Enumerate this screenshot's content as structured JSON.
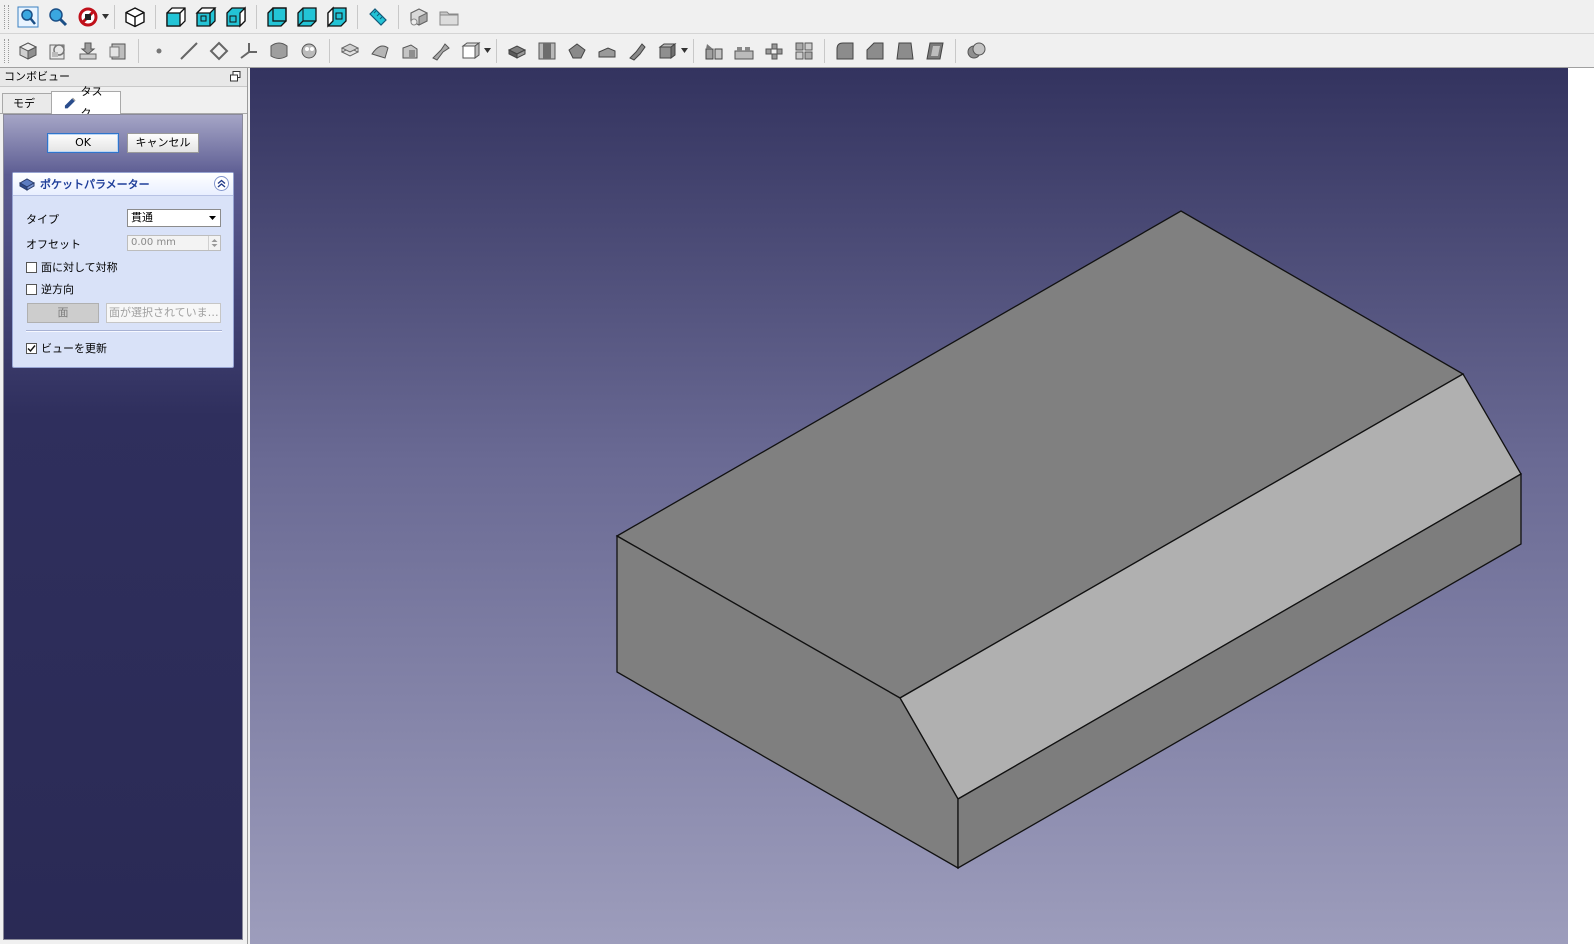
{
  "toolbar1": {
    "groups": [
      [
        "fit-all-icon",
        "fit-selection-icon",
        "draw-style-icon"
      ],
      [
        "isometric-view-icon"
      ],
      [
        "front-view-icon",
        "top-view-icon",
        "right-view-icon"
      ],
      [
        "rear-view-icon",
        "bottom-view-icon",
        "left-view-icon"
      ],
      [
        "measure-distance-icon"
      ],
      [
        "create-body-icon",
        "create-part-icon"
      ]
    ]
  },
  "toolbar2": {
    "icons": [
      "create-body-icon",
      "create-sketch-icon",
      "validate-sketch-icon",
      "clone-icon",
      "datum-point-icon",
      "datum-line-icon",
      "datum-plane-icon",
      "local-coordinate-icon",
      "shape-binder-icon",
      "subshape-binder-icon",
      "pad-icon",
      "revolution-icon",
      "additive-loft-icon",
      "additive-pipe-icon",
      "additive-primitive-icon",
      "pocket-icon",
      "hole-icon",
      "groove-icon",
      "subtractive-loft-icon",
      "subtractive-pipe-icon",
      "subtractive-primitive-icon",
      "mirrored-icon",
      "linear-pattern-icon",
      "polar-pattern-icon",
      "multitransform-icon",
      "fillet-icon",
      "chamfer-icon",
      "draft-icon",
      "thickness-icon",
      "boolean-icon"
    ]
  },
  "combo": {
    "title": "コンボビュー",
    "tabs": {
      "model": "モデル",
      "task": "タスク"
    },
    "ok": "OK",
    "cancel": "キャンセル",
    "pocket": {
      "title": "ポケットパラメーター",
      "type_label": "タイプ",
      "type_value": "貫通",
      "offset_label": "オフセット",
      "offset_value": "0.00 mm",
      "symmetric_label": "面に対して対称",
      "symmetric_checked": false,
      "reversed_label": "逆方向",
      "reversed_checked": false,
      "face_button": "面",
      "face_field": "面が選択されていま…",
      "update_view_label": "ビューを更新",
      "update_view_checked": true
    }
  },
  "colors": {
    "accent": "#2f75cc",
    "panel_header_text": "#1f3f9a",
    "model_top": "#808080",
    "model_chamfer": "#b0b0b0",
    "model_side": "#7d7d7d"
  }
}
